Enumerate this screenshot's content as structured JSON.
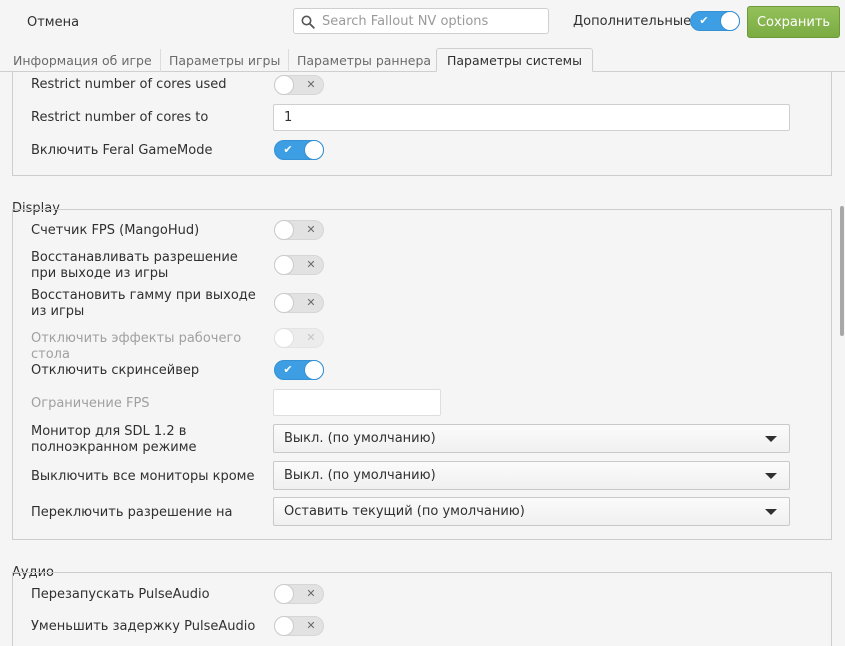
{
  "header": {
    "cancel_label": "Отмена",
    "search_placeholder": "Search Fallout NV options",
    "advanced_label": "Дополнительные",
    "advanced_enabled": true,
    "save_label": "Сохранить",
    "save_color": "#7aac42"
  },
  "tabs": [
    {
      "label": "Информация об игре",
      "active": false
    },
    {
      "label": "Параметры игры",
      "active": false
    },
    {
      "label": "Параметры раннера",
      "active": false
    },
    {
      "label": "Параметры системы",
      "active": true
    }
  ],
  "system_section": {
    "rows": [
      {
        "label": "Restrict number of cores used",
        "type": "switch",
        "state": false
      },
      {
        "label": "Restrict number of cores to",
        "type": "entry",
        "value": "1"
      },
      {
        "label": "Включить Feral GameMode",
        "type": "switch",
        "state": true
      }
    ]
  },
  "display_section": {
    "title": "Display",
    "rows": [
      {
        "label": "Счетчик FPS (MangoHud)",
        "type": "switch",
        "state": false
      },
      {
        "label": "Восстанавливать разрешение при выходе из игры",
        "type": "switch",
        "state": false
      },
      {
        "label": "Восстановить гамму при выходе из игры",
        "type": "switch",
        "state": false
      },
      {
        "label": "Отключить эффекты рабочего стола",
        "type": "switch",
        "state": false,
        "disabled": true
      },
      {
        "label": "Отключить скринсейвер",
        "type": "switch",
        "state": true
      },
      {
        "label": "Ограничение FPS",
        "type": "entry",
        "value": "",
        "disabled": true
      },
      {
        "label": "Монитор для SDL 1.2 в полноэкранном режиме",
        "type": "dropdown",
        "value": "Выкл. (по умолчанию)"
      },
      {
        "label": "Выключить все мониторы кроме",
        "type": "dropdown",
        "value": "Выкл. (по умолчанию)"
      },
      {
        "label": "Переключить разрешение на",
        "type": "dropdown",
        "value": "Оставить текущий (по умолчанию)"
      }
    ]
  },
  "audio_section": {
    "title": "Аудио",
    "rows": [
      {
        "label": "Перезапускать PulseAudio",
        "type": "switch",
        "state": false
      },
      {
        "label": "Уменьшить задержку PulseAudio",
        "type": "switch",
        "state": false
      }
    ]
  },
  "colors": {
    "switch_on": "#3d9ee3",
    "switch_off": "#e2e2e2"
  },
  "icons": {
    "search": "search-icon",
    "switch_on_glyph": "✔",
    "switch_off_glyph": "✕",
    "dropdown_arrow": "chevron-down-icon"
  }
}
